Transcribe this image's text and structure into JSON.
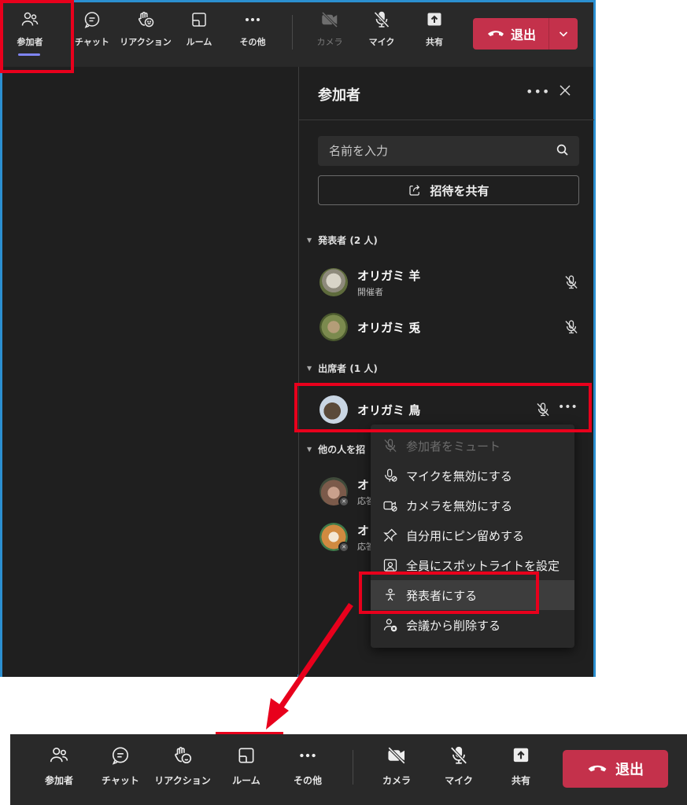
{
  "toolbar": {
    "buttons": [
      {
        "label": "参加者",
        "icon": "people-icon"
      },
      {
        "label": "チャット",
        "icon": "chat-icon"
      },
      {
        "label": "リアクション",
        "icon": "reaction-icon"
      },
      {
        "label": "ルーム",
        "icon": "rooms-icon"
      },
      {
        "label": "その他",
        "icon": "more-icon"
      },
      {
        "label": "カメラ",
        "icon": "camera-off-icon"
      },
      {
        "label": "マイク",
        "icon": "mic-off-icon"
      },
      {
        "label": "共有",
        "icon": "share-icon"
      }
    ],
    "leave_label": "退出"
  },
  "panel": {
    "title": "参加者",
    "search_placeholder": "名前を入力",
    "invite_label": "招待を共有",
    "sections": {
      "presenters": "発表者 (2 人)",
      "attendees": "出席者 (1 人)",
      "others": "他の人を招"
    },
    "people": [
      {
        "name": "オリガミ 羊",
        "role": "開催者"
      },
      {
        "name": "オリガミ 兎",
        "role": ""
      },
      {
        "name": "オリガミ 鳥",
        "role": ""
      },
      {
        "name": "オリ",
        "role": "応答"
      },
      {
        "name": "オリ",
        "role": "応答"
      }
    ]
  },
  "context_menu": {
    "items": [
      {
        "label": "参加者をミュート",
        "icon": "mic-off-icon",
        "disabled": true
      },
      {
        "label": "マイクを無効にする",
        "icon": "mic-disable-icon",
        "disabled": false
      },
      {
        "label": "カメラを無効にする",
        "icon": "camera-disable-icon",
        "disabled": false
      },
      {
        "label": "自分用にピン留めする",
        "icon": "pin-icon",
        "disabled": false
      },
      {
        "label": "全員にスポットライトを設定",
        "icon": "spotlight-icon",
        "disabled": false
      },
      {
        "label": "発表者にする",
        "icon": "presenter-icon",
        "disabled": false
      },
      {
        "label": "会議から削除する",
        "icon": "remove-person-icon",
        "disabled": false
      }
    ]
  },
  "bottom_bar": {
    "buttons": [
      {
        "label": "参加者"
      },
      {
        "label": "チャット"
      },
      {
        "label": "リアクション"
      },
      {
        "label": "ルーム"
      },
      {
        "label": "その他"
      },
      {
        "label": "カメラ"
      },
      {
        "label": "マイク"
      },
      {
        "label": "共有"
      }
    ],
    "leave_label": "退出"
  },
  "colors": {
    "leave_red": "#c4314b",
    "highlight_red": "#e8001c",
    "window_border": "#2b8fd0",
    "panel_bg": "#1f1f1f",
    "toolbar_bg": "#292929",
    "active_underline": "#7f85f5"
  }
}
